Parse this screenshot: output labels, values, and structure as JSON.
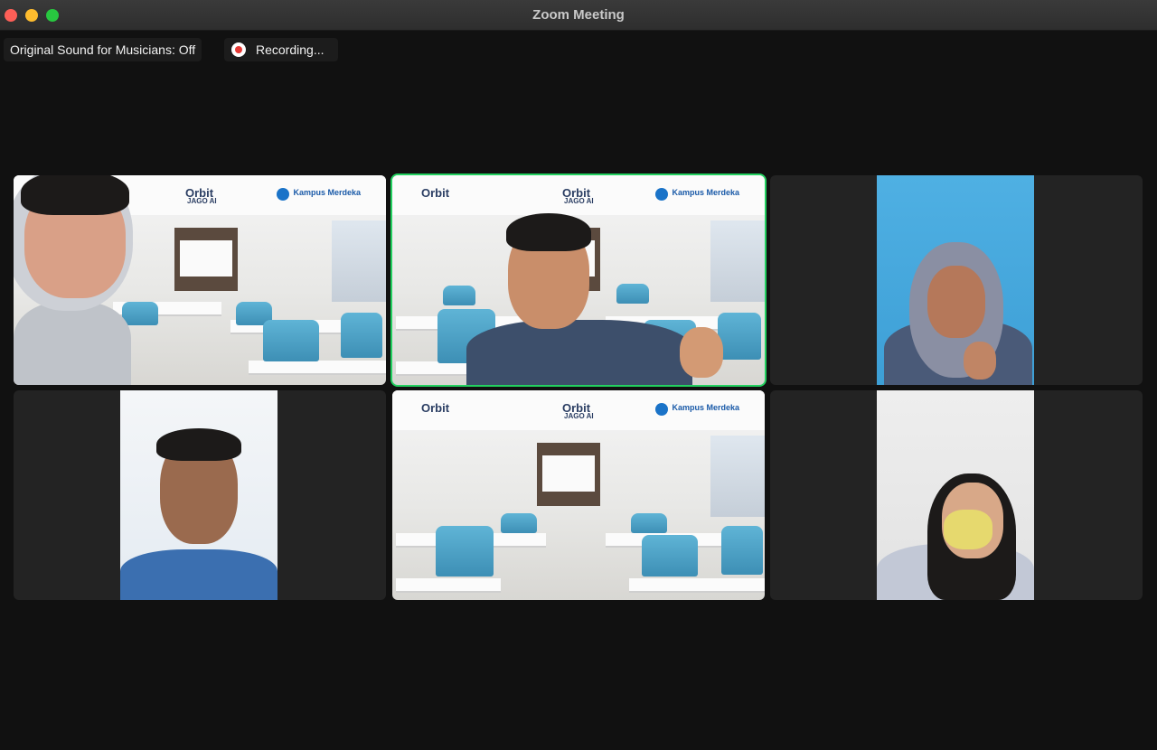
{
  "window": {
    "title": "Zoom Meeting"
  },
  "status": {
    "original_sound": "Original Sound for Musicians: Off",
    "recording": "Recording..."
  },
  "accent": {
    "active_speaker": "#23d160",
    "recording": "#e53935"
  },
  "banner": {
    "orbit": "Orbit",
    "jago_ai": "JAGO AI",
    "kampus": "Kampus Merdeka"
  },
  "tiles": [
    {
      "id": "top-left",
      "active": false
    },
    {
      "id": "top-center",
      "active": true
    },
    {
      "id": "top-right",
      "active": false
    },
    {
      "id": "bottom-left",
      "active": false
    },
    {
      "id": "bottom-center",
      "active": false
    },
    {
      "id": "bottom-right",
      "active": false
    }
  ]
}
